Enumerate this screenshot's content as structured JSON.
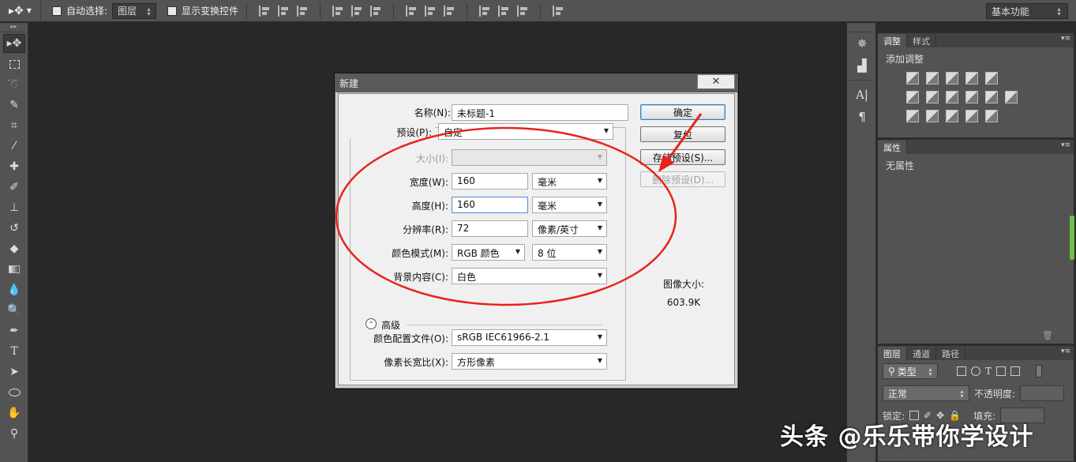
{
  "options_bar": {
    "auto_select_label": "自动选择:",
    "auto_select_value": "图层",
    "show_transform_label": "显示变换控件",
    "workspace": "基本功能"
  },
  "panels": {
    "adjustments": {
      "tabs": [
        "调整",
        "样式"
      ],
      "title": "添加调整"
    },
    "properties": {
      "tab": "属性",
      "text": "无属性"
    },
    "layers": {
      "tabs": [
        "图层",
        "通道",
        "路径"
      ],
      "filter_kind": "类型",
      "blend_mode": "正常",
      "opacity_label": "不透明度:",
      "lock_label": "锁定:",
      "fill_label": "填充:"
    }
  },
  "dialog": {
    "title": "新建",
    "close_label": "✕",
    "fields": {
      "name_label": "名称(N):",
      "name_value": "未标题-1",
      "preset_label": "预设(P):",
      "preset_value": "自定",
      "size_label": "大小(I):",
      "width_label": "宽度(W):",
      "width_value": "160",
      "width_unit": "毫米",
      "height_label": "高度(H):",
      "height_value": "160",
      "height_unit": "毫米",
      "resolution_label": "分辨率(R):",
      "resolution_value": "72",
      "resolution_unit": "像素/英寸",
      "color_mode_label": "颜色模式(M):",
      "color_mode_value": "RGB 颜色",
      "bit_depth_value": "8 位",
      "background_label": "背景内容(C):",
      "background_value": "白色",
      "advanced_label": "高级",
      "color_profile_label": "颜色配置文件(O):",
      "color_profile_value": "sRGB IEC61966-2.1",
      "pixel_aspect_label": "像素长宽比(X):",
      "pixel_aspect_value": "方形像素"
    },
    "buttons": {
      "ok": "确定",
      "reset": "复位",
      "save_preset": "存储预设(S)...",
      "delete_preset": "删除预设(D)..."
    },
    "image_size_label": "图像大小:",
    "image_size_value": "603.9K"
  },
  "annotation": {
    "color": "#e8231c"
  },
  "watermark": "头条 @乐乐带你学设计"
}
